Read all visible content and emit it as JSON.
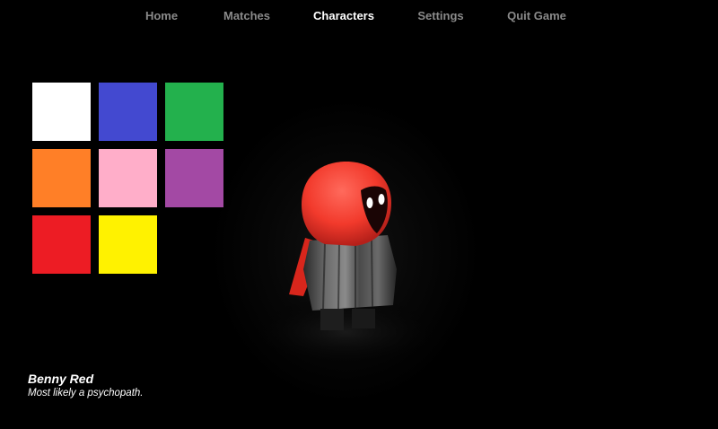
{
  "nav": {
    "items": [
      {
        "label": "Home",
        "active": false
      },
      {
        "label": "Matches",
        "active": false
      },
      {
        "label": "Characters",
        "active": true
      },
      {
        "label": "Settings",
        "active": false
      },
      {
        "label": "Quit Game",
        "active": false
      }
    ]
  },
  "palette": {
    "swatches": [
      {
        "name": "white",
        "color": "#ffffff"
      },
      {
        "name": "blue",
        "color": "#4349d0"
      },
      {
        "name": "green",
        "color": "#23b14d"
      },
      {
        "name": "orange",
        "color": "#ff7f27"
      },
      {
        "name": "pink",
        "color": "#ffaec9"
      },
      {
        "name": "purple",
        "color": "#a349a4"
      },
      {
        "name": "red",
        "color": "#ed1c24"
      },
      {
        "name": "yellow",
        "color": "#fff200"
      }
    ]
  },
  "character": {
    "name": "Benny Red",
    "description": "Most likely a psychopath.",
    "hood_color": "#ff4a3d"
  }
}
